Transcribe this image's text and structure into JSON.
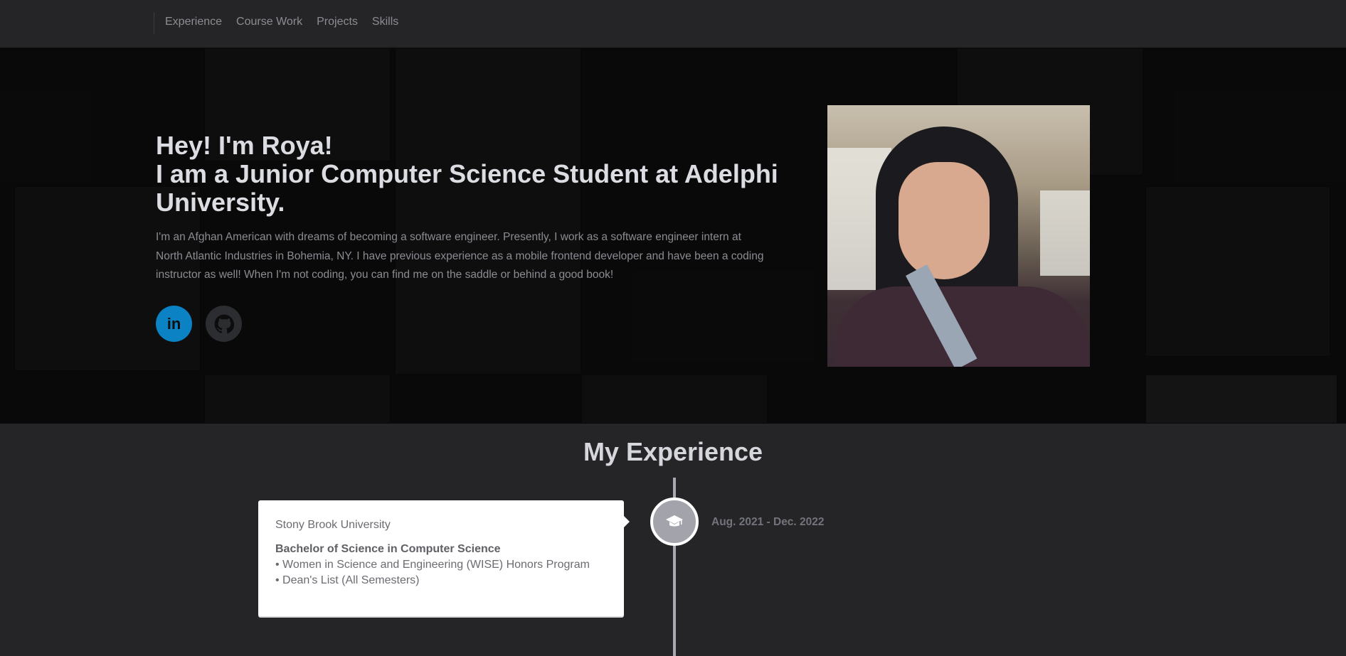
{
  "nav": {
    "links": [
      "Experience",
      "Course Work",
      "Projects",
      "Skills"
    ]
  },
  "hero": {
    "title_line1": "Hey! I'm Roya!",
    "title_line2": "I am a Junior Computer Science Student at Adelphi University.",
    "description": "I'm an Afghan American with dreams of becoming a software engineer. Presently, I work as a software engineer intern at North Atlantic Industries in Bohemia, NY. I have previous experience as a mobile frontend developer and have been a coding instructor as well! When I'm not coding, you can find me on the saddle or behind a good book!",
    "social": [
      {
        "icon": "linkedin-icon",
        "label": "in"
      },
      {
        "icon": "github-icon"
      }
    ],
    "colors": {
      "linkedin": "#0a82c4",
      "github_bg": "#2c2d30"
    }
  },
  "experience": {
    "section_title": "My Experience",
    "items": [
      {
        "organization": "Stony Brook University",
        "degree": "Bachelor of Science in Computer Science",
        "bullets": [
          "• Women in Science and Engineering (WISE) Honors Program",
          "• Dean's List (All Semesters)"
        ],
        "date": "Aug. 2021 - Dec. 2022",
        "icon": "graduation-cap-icon"
      }
    ]
  },
  "theme": {
    "background": "#252527",
    "hero_background": "#0d0d0e",
    "timeline_line": "#a9aab1"
  }
}
